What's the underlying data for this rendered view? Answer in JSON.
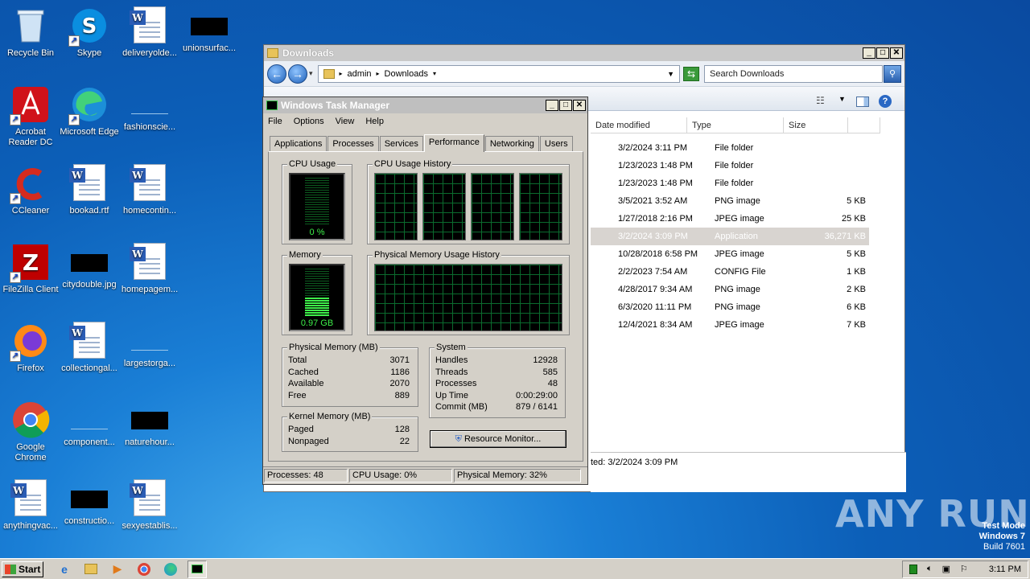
{
  "desktop": {
    "icons": [
      {
        "label": "Recycle Bin"
      },
      {
        "label": "Skype"
      },
      {
        "label": "deliveryolde..."
      },
      {
        "label": "unionsurfac..."
      },
      {
        "label": "Acrobat Reader DC"
      },
      {
        "label": "Microsoft Edge"
      },
      {
        "label": "fashionscie..."
      },
      {
        "label": "CCleaner"
      },
      {
        "label": "bookad.rtf"
      },
      {
        "label": "homecontin..."
      },
      {
        "label": "FileZilla Client"
      },
      {
        "label": "citydouble.jpg"
      },
      {
        "label": "homepagem..."
      },
      {
        "label": "Firefox"
      },
      {
        "label": "collectiongal..."
      },
      {
        "label": "largestorga..."
      },
      {
        "label": "Google Chrome"
      },
      {
        "label": "component..."
      },
      {
        "label": "naturehour..."
      },
      {
        "label": "anythingvac..."
      },
      {
        "label": "constructio..."
      },
      {
        "label": "sexyestablis..."
      }
    ]
  },
  "explorer": {
    "title": "Downloads",
    "breadcrumb": [
      "admin",
      "Downloads"
    ],
    "search_placeholder": "Search Downloads",
    "columns": {
      "date": "Date modified",
      "type": "Type",
      "size": "Size"
    },
    "rows": [
      {
        "date": "3/2/2024 3:11 PM",
        "type": "File folder",
        "size": ""
      },
      {
        "date": "1/23/2023 1:48 PM",
        "type": "File folder",
        "size": ""
      },
      {
        "date": "1/23/2023 1:48 PM",
        "type": "File folder",
        "size": ""
      },
      {
        "date": "3/5/2021 3:52 AM",
        "type": "PNG image",
        "size": "5 KB"
      },
      {
        "date": "1/27/2018 2:16 PM",
        "type": "JPEG image",
        "size": "25 KB"
      },
      {
        "date": "3/2/2024 3:09 PM",
        "type": "Application",
        "size": "36,271 KB"
      },
      {
        "date": "10/28/2018 6:58 PM",
        "type": "JPEG image",
        "size": "5 KB"
      },
      {
        "date": "2/2/2023 7:54 AM",
        "type": "CONFIG File",
        "size": "1 KB"
      },
      {
        "date": "4/28/2017 9:34 AM",
        "type": "PNG image",
        "size": "2 KB"
      },
      {
        "date": "6/3/2020 11:11 PM",
        "type": "PNG image",
        "size": "6 KB"
      },
      {
        "date": "12/4/2021 8:34 AM",
        "type": "JPEG image",
        "size": "7 KB"
      }
    ],
    "details_text": "ted:  3/2/2024 3:09 PM"
  },
  "taskmgr": {
    "title": "Windows Task Manager",
    "menu": [
      "File",
      "Options",
      "View",
      "Help"
    ],
    "tabs": [
      "Applications",
      "Processes",
      "Services",
      "Performance",
      "Networking",
      "Users"
    ],
    "cpu_usage_label": "CPU Usage",
    "cpu_usage_value": "0 %",
    "cpu_history_label": "CPU Usage History",
    "memory_label": "Memory",
    "memory_value": "0.97 GB",
    "memory_fraction": 0.32,
    "phys_history_label": "Physical Memory Usage History",
    "physical_memory": {
      "title": "Physical Memory (MB)",
      "rows": [
        {
          "k": "Total",
          "v": "3071"
        },
        {
          "k": "Cached",
          "v": "1186"
        },
        {
          "k": "Available",
          "v": "2070"
        },
        {
          "k": "Free",
          "v": "889"
        }
      ]
    },
    "kernel_memory": {
      "title": "Kernel Memory (MB)",
      "rows": [
        {
          "k": "Paged",
          "v": "128"
        },
        {
          "k": "Nonpaged",
          "v": "22"
        }
      ]
    },
    "system": {
      "title": "System",
      "rows": [
        {
          "k": "Handles",
          "v": "12928"
        },
        {
          "k": "Threads",
          "v": "585"
        },
        {
          "k": "Processes",
          "v": "48"
        },
        {
          "k": "Up Time",
          "v": "0:00:29:00"
        },
        {
          "k": "Commit (MB)",
          "v": "879 / 6141"
        }
      ]
    },
    "resource_monitor_button": "Resource Monitor...",
    "status": {
      "processes": "Processes: 48",
      "cpu": "CPU Usage: 0%",
      "memory": "Physical Memory: 32%"
    }
  },
  "taskbar": {
    "start_label": "Start",
    "clock": "3:11 PM"
  },
  "watermark": {
    "line1": "Test Mode",
    "line2": "Windows 7",
    "line3": "Build 7601",
    "brand": "ANY RUN"
  }
}
